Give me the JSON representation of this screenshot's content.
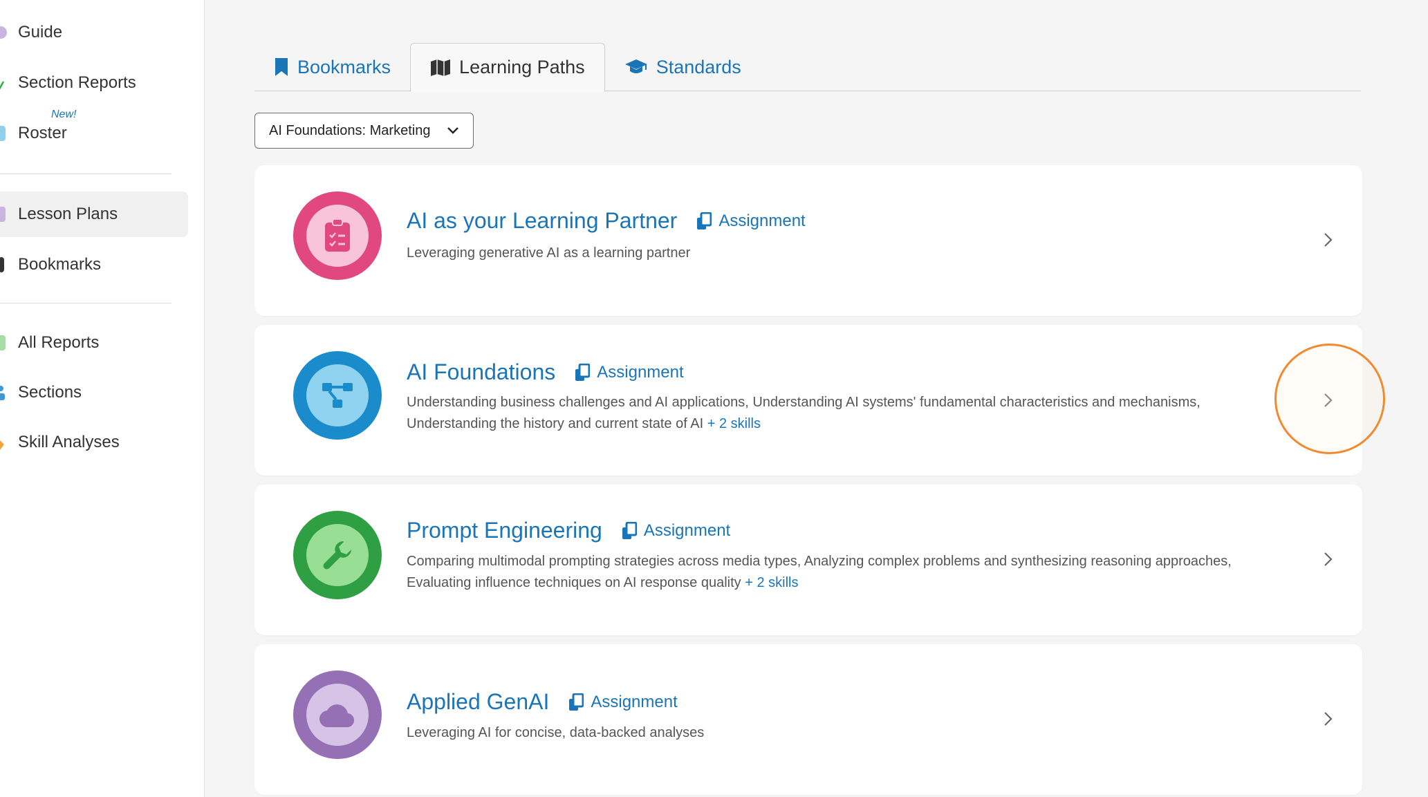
{
  "sidebar": {
    "items": [
      {
        "label": "Guide",
        "nub_color": "#c9b6e0"
      },
      {
        "label": "Section Reports",
        "nub_color": "#2fae4d"
      },
      {
        "label": "Roster",
        "badge": "New!",
        "nub_color": "#8fd0ee"
      },
      {
        "label": "Lesson Plans",
        "nub_color": "#c9b6e0",
        "active": true
      },
      {
        "label": "Bookmarks",
        "nub_color": "#333333"
      },
      {
        "label": "All Reports",
        "nub_color": "#a6dca6"
      },
      {
        "label": "Sections",
        "nub_color": "#3d9ad6"
      },
      {
        "label": "Skill Analyses",
        "nub_color": "#f0a53c"
      }
    ]
  },
  "tabs": [
    {
      "label": "Bookmarks",
      "icon": "bookmark-icon"
    },
    {
      "label": "Learning Paths",
      "icon": "map-icon",
      "active": true
    },
    {
      "label": "Standards",
      "icon": "graduation-cap-icon"
    }
  ],
  "filter": {
    "selected": "AI Foundations: Marketing"
  },
  "cards": [
    {
      "title": "AI as your Learning Partner",
      "assignment_label": "Assignment",
      "description": "Leveraging generative AI as a learning partner",
      "more": "",
      "icon": "clipboard-check-icon",
      "outer_color": "#e0487f",
      "inner_color": "#f9c4d8"
    },
    {
      "title": "AI Foundations",
      "assignment_label": "Assignment",
      "description": "Understanding business challenges and AI applications, Understanding AI systems' fundamental characteristics and mechanisms, Understanding the history and current state of AI",
      "more": "+ 2 skills",
      "icon": "network-icon",
      "outer_color": "#1a8ccc",
      "inner_color": "#8fd3f0"
    },
    {
      "title": "Prompt Engineering",
      "assignment_label": "Assignment",
      "description": "Comparing multimodal prompting strategies across media types, Analyzing complex problems and synthesizing reasoning approaches, Evaluating influence techniques on AI response quality",
      "more": "+ 2 skills",
      "icon": "wrench-icon",
      "outer_color": "#2ea043",
      "inner_color": "#98de94"
    },
    {
      "title": "Applied GenAI",
      "assignment_label": "Assignment",
      "description": "Leveraging AI for concise, data-backed analyses",
      "more": "",
      "icon": "cloud-icon",
      "outer_color": "#9670b4",
      "inner_color": "#d6c4e6"
    }
  ],
  "colors": {
    "accent": "#1a75b8",
    "highlight": "#f08a2c"
  }
}
